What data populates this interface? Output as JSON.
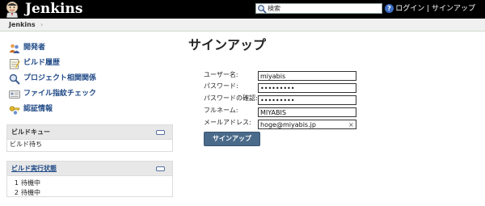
{
  "header": {
    "app_title": "Jenkins",
    "search": {
      "value": "検索"
    },
    "help_glyph": "?",
    "links": {
      "login": "ログイン",
      "separator": " | ",
      "signup": "サインアップ"
    }
  },
  "breadcrumb": {
    "items": [
      "Jenkins"
    ],
    "separator": "›"
  },
  "sidebar": {
    "tasks": [
      {
        "label": "開発者",
        "icon": "people-icon"
      },
      {
        "label": "ビルド履歴",
        "icon": "notepad-icon"
      },
      {
        "label": "プロジェクト相関関係",
        "icon": "search-icon"
      },
      {
        "label": "ファイル指紋チェック",
        "icon": "fingerprint-icon"
      },
      {
        "label": "認証情報",
        "icon": "credentials-icon"
      }
    ],
    "build_queue": {
      "title": "ビルドキュー",
      "status": "ビルド待ち"
    },
    "executors": {
      "title": "ビルド実行状態",
      "rows": [
        {
          "num": "1",
          "status": "待機中"
        },
        {
          "num": "2",
          "status": "待機中"
        }
      ]
    }
  },
  "signup": {
    "title": "サインアップ",
    "fields": {
      "username": {
        "label": "ユーザー名:",
        "value": "miyabis"
      },
      "password": {
        "label": "パスワード:",
        "value": "miyabis00"
      },
      "password_confirm": {
        "label": "パスワードの確認:",
        "value": "miyabis00"
      },
      "fullname": {
        "label": "フルネーム:",
        "value": "MIYABIS"
      },
      "email": {
        "label": "メールアドレス:",
        "value": "hoge@miyabis.jp"
      }
    },
    "clear_glyph": "×",
    "submit_label": "サインアップ"
  },
  "colors": {
    "header_bg": "#000000",
    "link": "#204a87",
    "button_bg": "#4a6a8a",
    "pane_header_bg": "#e8e8e8"
  }
}
